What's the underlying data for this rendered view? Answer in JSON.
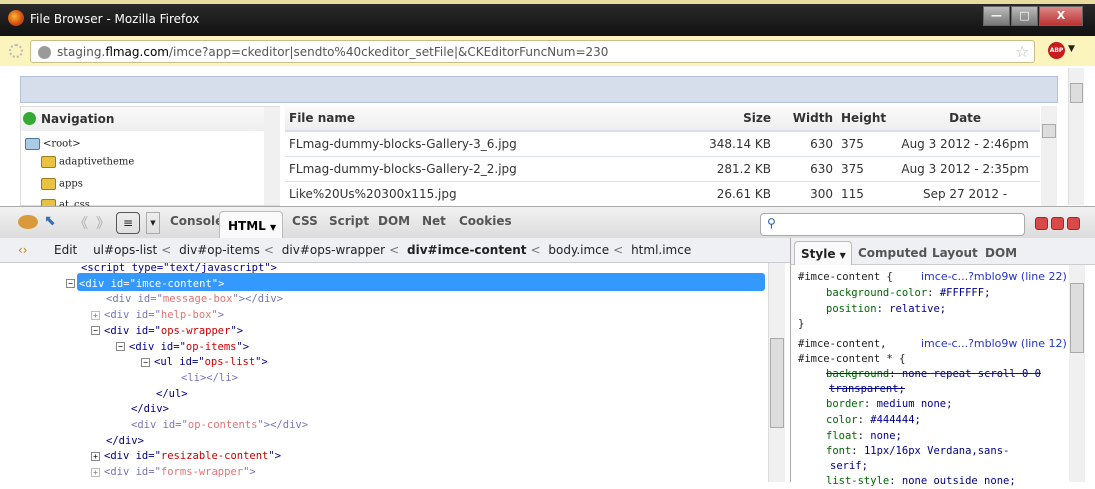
{
  "window": {
    "title": "File Browser - Mozilla Firefox",
    "min": "—",
    "max": "□",
    "close": "X"
  },
  "address": {
    "url_host_pre": "staging.",
    "url_host": "flmag.com",
    "url_path": "/imce?app=ckeditor|sendto%40ckeditor_setFile|&CKEditorFuncNum=230",
    "addon": "ABP"
  },
  "navigation": {
    "title": "Navigation",
    "items": [
      "<root>",
      "adaptivetheme",
      "apps",
      "at_css"
    ]
  },
  "files": {
    "headers": [
      "File name",
      "Size",
      "Width",
      "Height",
      "Date"
    ],
    "rows": [
      [
        "FLmag-dummy-blocks-Gallery-3_6.jpg",
        "348.14 KB",
        "630",
        "375",
        "Aug 3 2012 - 2:46pm"
      ],
      [
        "FLmag-dummy-blocks-Gallery-2_2.jpg",
        "281.2 KB",
        "630",
        "375",
        "Aug 3 2012 - 2:35pm"
      ],
      [
        "Like%20Us%20300x115.jpg",
        "26.61 KB",
        "300",
        "115",
        "Sep 27 2012 -"
      ]
    ]
  },
  "firebug": {
    "tabs": [
      "Console",
      "HTML",
      "CSS",
      "Script",
      "DOM",
      "Net",
      "Cookies"
    ],
    "edit": "Edit",
    "breadcrumbs": [
      "ul#ops-list",
      "div#op-items",
      "div#ops-wrapper",
      "div#imce-content",
      "body.imce",
      "html.imce"
    ],
    "side_tabs": [
      "Style",
      "Computed",
      "Layout",
      "DOM"
    ],
    "html_lines": [
      {
        "t": "<script type=\"text/javascript\">",
        "ind": 0
      },
      {
        "tag": "div",
        "id": "imce-content",
        "ind": 0,
        "tw": "−",
        "sel": true
      },
      {
        "tag": "div",
        "id": "message-box",
        "ind": 1,
        "close": true,
        "dim": true
      },
      {
        "tag": "div",
        "id": "help-box",
        "ind": 1,
        "tw": "+",
        "dim": true
      },
      {
        "tag": "div",
        "id": "ops-wrapper",
        "ind": 1,
        "tw": "−"
      },
      {
        "tag": "div",
        "id": "op-items",
        "ind": 2,
        "tw": "−"
      },
      {
        "tag": "ul",
        "id": "ops-list",
        "ind": 3,
        "tw": "−"
      },
      {
        "t": "<li></li>",
        "ind": 4,
        "dim": true
      },
      {
        "t": "</ul>",
        "ind": 3
      },
      {
        "t": "</div>",
        "ind": 2
      },
      {
        "tag": "div",
        "id": "op-contents",
        "ind": 2,
        "close": true,
        "dim": true
      },
      {
        "t": "</div>",
        "ind": 1
      },
      {
        "tag": "div",
        "id": "resizable-content",
        "ind": 1,
        "tw": "+"
      },
      {
        "tag": "div",
        "id": "forms-wrapper",
        "ind": 1,
        "tw": "+",
        "dim": true
      }
    ],
    "styles": {
      "rule1": {
        "selector": "#imce-content {",
        "source": "imce-c...?mblo9w (line 22)",
        "props": [
          [
            "background-color",
            "#FFFFFF;"
          ],
          [
            "position",
            "relative;"
          ]
        ],
        "close": "}"
      },
      "rule2": {
        "selector": "#imce-content,",
        "selector2": "#imce-content * {",
        "source": "imce-c...?mblo9w (line 12)",
        "strike": [
          "background",
          "none repeat scroll 0 0",
          "transparent;"
        ],
        "props": [
          [
            "border",
            "medium none;"
          ],
          [
            "color",
            "#444444;"
          ],
          [
            "float",
            "none;"
          ],
          [
            "font",
            "11px/16px Verdana,sans-"
          ]
        ],
        "font_cont": "serif;",
        "last": [
          "list-style",
          "none outside none;"
        ]
      }
    }
  }
}
